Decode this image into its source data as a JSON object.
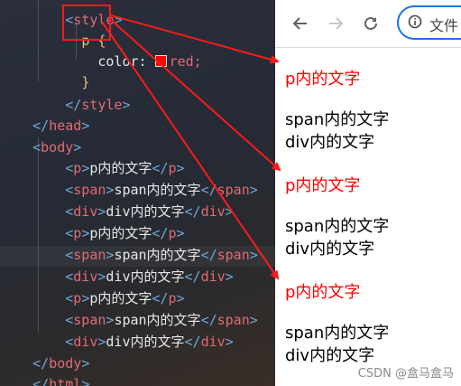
{
  "editor": {
    "lines": [
      {
        "indent": "    ",
        "kind": "tag",
        "text": "style",
        "close": false
      },
      {
        "indent": "      ",
        "kind": "selector",
        "text": "p {"
      },
      {
        "indent": "        ",
        "kind": "decl",
        "prop": "color: ",
        "value": "red;"
      },
      {
        "indent": "      ",
        "kind": "brace",
        "text": "}"
      },
      {
        "indent": "    ",
        "kind": "tag",
        "text": "style",
        "close": true
      },
      {
        "indent": "",
        "kind": "tag",
        "text": "head",
        "close": true
      },
      {
        "indent": "",
        "kind": "tag",
        "text": "body",
        "close": false
      },
      {
        "indent": "    ",
        "kind": "elem",
        "tag": "p",
        "content": "p内的文字"
      },
      {
        "indent": "    ",
        "kind": "elem",
        "tag": "span",
        "content": "span内的文字"
      },
      {
        "indent": "    ",
        "kind": "elem",
        "tag": "div",
        "content": "div内的文字"
      },
      {
        "indent": "    ",
        "kind": "elem",
        "tag": "p",
        "content": "p内的文字"
      },
      {
        "indent": "    ",
        "kind": "elem",
        "tag": "span",
        "content": "span内的文字"
      },
      {
        "indent": "    ",
        "kind": "elem",
        "tag": "div",
        "content": "div内的文字"
      },
      {
        "indent": "    ",
        "kind": "elem",
        "tag": "p",
        "content": "p内的文字"
      },
      {
        "indent": "    ",
        "kind": "elem",
        "tag": "span",
        "content": "span内的文字"
      },
      {
        "indent": "    ",
        "kind": "elem",
        "tag": "div",
        "content": "div内的文字"
      },
      {
        "indent": "",
        "kind": "tag",
        "text": "body",
        "close": true
      },
      {
        "indent": "",
        "kind": "tag",
        "text": "html",
        "close": true
      }
    ],
    "highlighted_line": 12,
    "color_swatch": "#ff0000"
  },
  "browser": {
    "address_text": "文件",
    "output": [
      {
        "text": "p内的文字",
        "red": true
      },
      {
        "text": "span内的文字",
        "red": false
      },
      {
        "text": "div内的文字",
        "red": false
      },
      {
        "text": "p内的文字",
        "red": true
      },
      {
        "text": "span内的文字",
        "red": false
      },
      {
        "text": "div内的文字",
        "red": false
      },
      {
        "text": "p内的文字",
        "red": true
      },
      {
        "text": "span内的文字",
        "red": false
      },
      {
        "text": "div内的文字",
        "red": false
      }
    ],
    "watermark": "CSDN @盒马盒马"
  },
  "colors": {
    "annotation": "#ff1a1a",
    "p_output": "#ff0000",
    "address_border": "#1a73e8"
  }
}
